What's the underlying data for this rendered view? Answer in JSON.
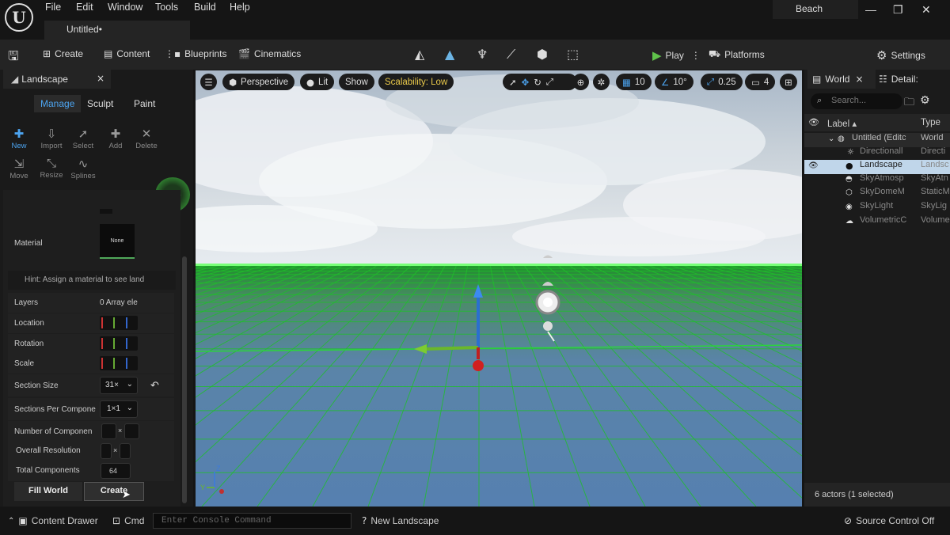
{
  "menu": [
    "File",
    "Edit",
    "Window",
    "Tools",
    "Build",
    "Help"
  ],
  "tab_title": "Untitled•",
  "project": "Beach",
  "toolbar": {
    "create": "Create",
    "content": "Content",
    "blueprints": "Blueprints",
    "cinematics": "Cinematics",
    "play": "Play",
    "platforms": "Platforms",
    "settings": "Settings"
  },
  "landscape": {
    "tab": "Landscape",
    "modes": [
      "Manage",
      "Sculpt",
      "Paint"
    ],
    "tools": [
      "New",
      "Import",
      "Select",
      "Add",
      "Delete",
      "Move",
      "Resize",
      "Splines"
    ],
    "material_label": "Material",
    "material_value": "None",
    "hint": "Hint: Assign a material to see land",
    "layers_label": "Layers",
    "layers_value": "0 Array ele",
    "location_label": "Location",
    "rotation_label": "Rotation",
    "scale_label": "Scale",
    "section_size_label": "Section Size",
    "section_size_value": "31×",
    "sections_per_label": "Sections Per Compone",
    "sections_per_value": "1×1",
    "num_components_label": "Number of Componen",
    "overall_res_label": "Overall Resolution",
    "total_components_label": "Total Components",
    "total_components_value": "64",
    "fill_world": "Fill World",
    "create": "Create"
  },
  "viewport": {
    "perspective": "Perspective",
    "lit": "Lit",
    "show": "Show",
    "scalability": "Scalability: Low",
    "grid": "10",
    "angle": "10°",
    "scale": "0.25",
    "camera": "4"
  },
  "outliner": {
    "world_tab": "World",
    "details_tab": "Detail:",
    "search_placeholder": "Search...",
    "col_label": "Label ▴",
    "col_type": "Type",
    "rows": [
      {
        "label": "Untitled (Editc",
        "type": "World"
      },
      {
        "label": "Directionall",
        "type": "Directi"
      },
      {
        "label": "Landscape",
        "type": "Landsc"
      },
      {
        "label": "SkyAtmosp",
        "type": "SkyAtn"
      },
      {
        "label": "SkyDomeM",
        "type": "StaticM"
      },
      {
        "label": "SkyLight",
        "type": "SkyLig"
      },
      {
        "label": "VolumetricC",
        "type": "Volume"
      }
    ],
    "actors": "6 actors (1 selected)"
  },
  "status": {
    "content_drawer": "Content Drawer",
    "cmd": "Cmd",
    "console_placeholder": "Enter Console Command",
    "new_landscape": "New Landscape",
    "source_control": "Source Control Off"
  }
}
